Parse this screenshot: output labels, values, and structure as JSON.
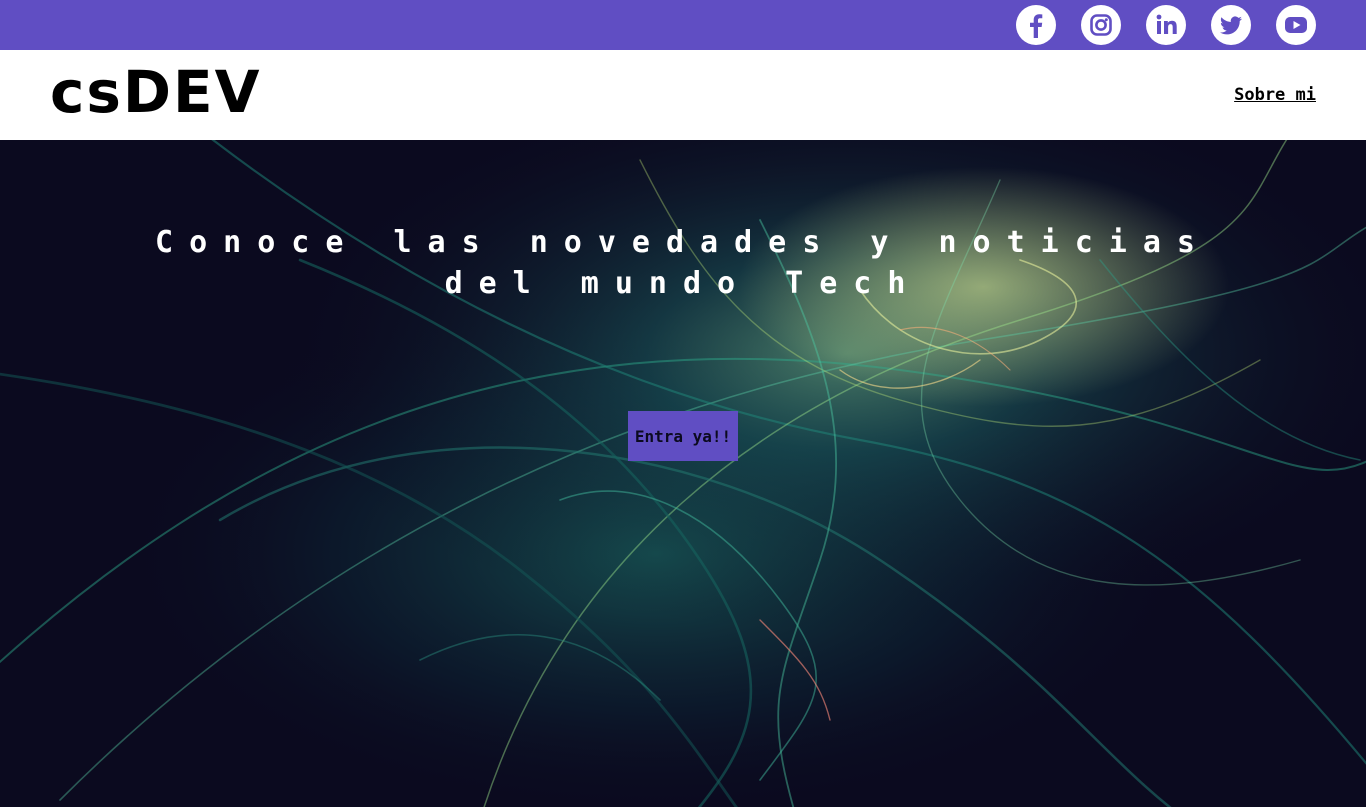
{
  "colors": {
    "brand": "#604ec3",
    "header_bg": "#ffffff",
    "hero_bg": "#0b0a1f",
    "text_dark": "#000000",
    "text_light": "#ffffff"
  },
  "topbar": {
    "social": [
      {
        "icon": "facebook-icon"
      },
      {
        "icon": "instagram-icon"
      },
      {
        "icon": "linkedin-icon"
      },
      {
        "icon": "twitter-icon"
      },
      {
        "icon": "youtube-icon"
      }
    ]
  },
  "header": {
    "logo": "csDEV",
    "nav": {
      "about_label": "Sobre mi"
    }
  },
  "hero": {
    "title_line1": "Conoce las novedades y noticias",
    "title_line2": "del mundo Tech",
    "cta_label": "Entra ya!!"
  }
}
